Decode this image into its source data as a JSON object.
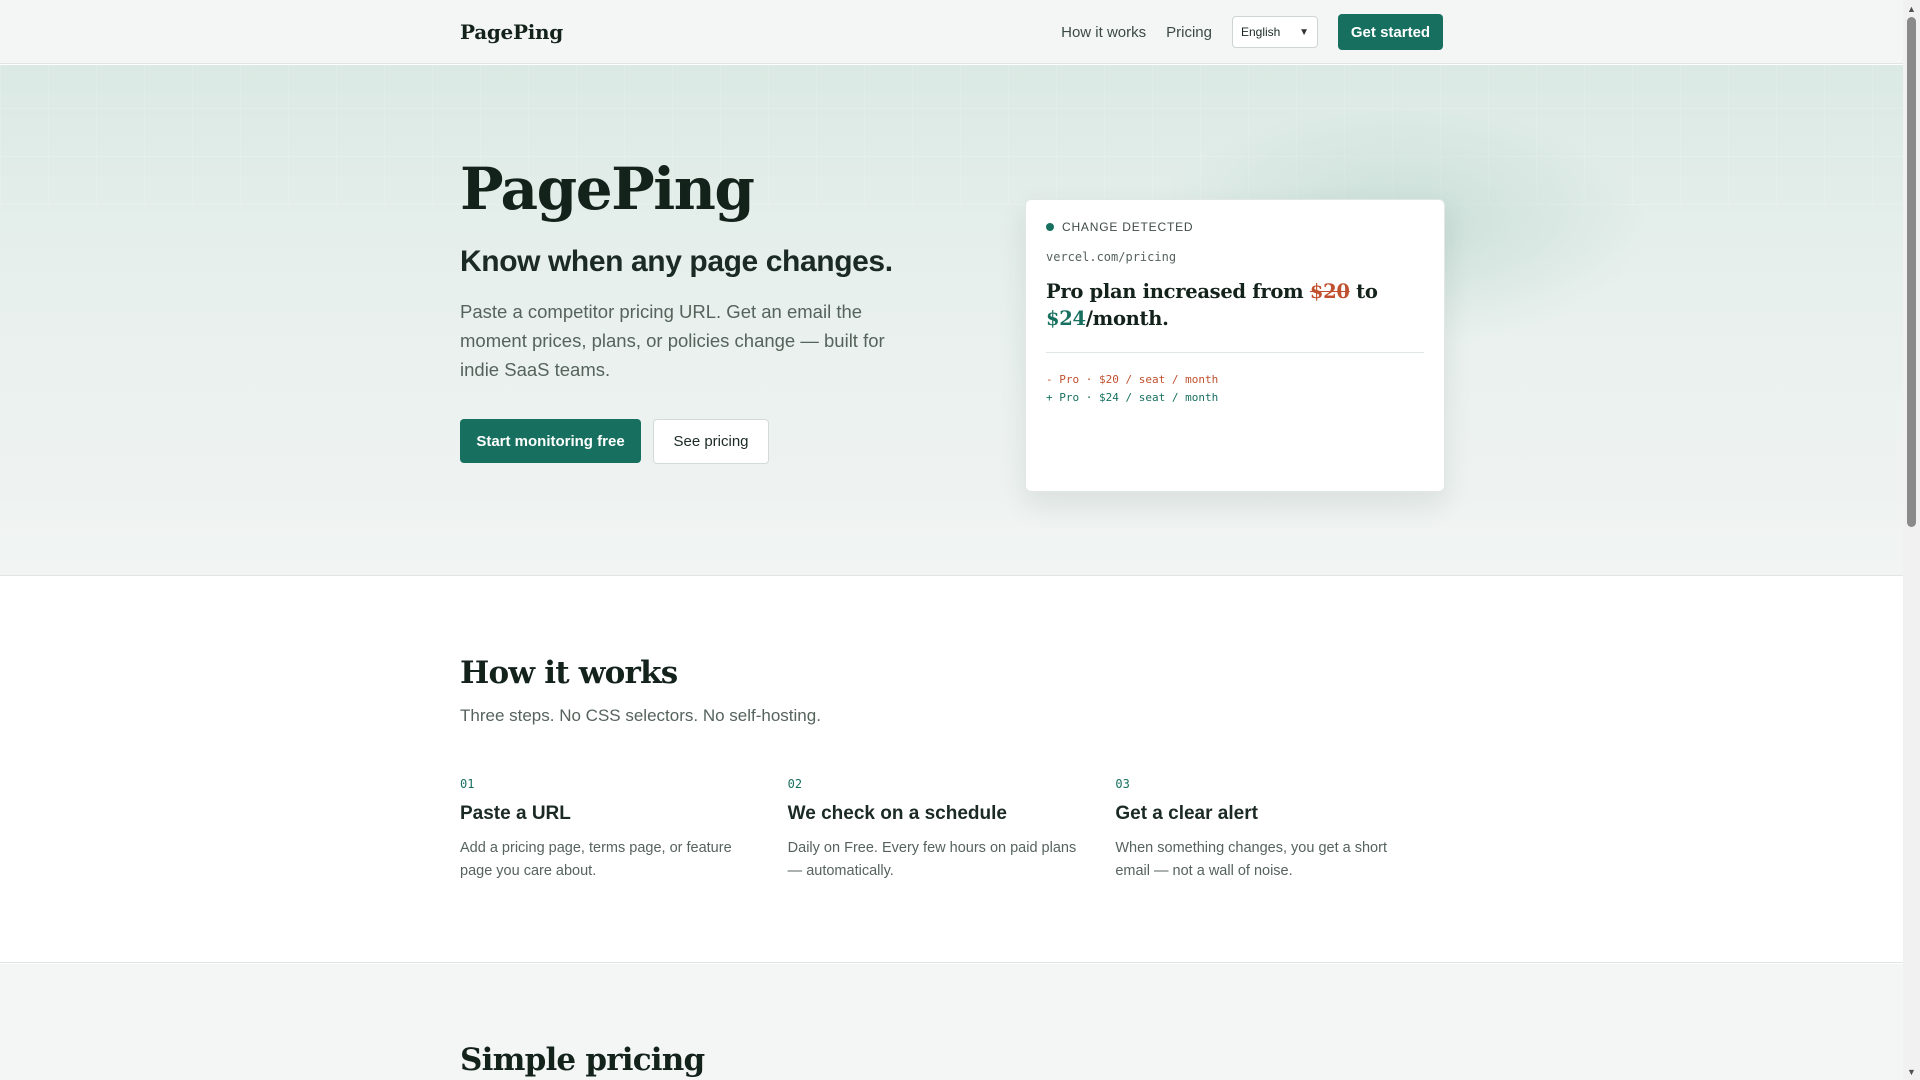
{
  "header": {
    "logo": "PagePing",
    "nav": [
      "How it works",
      "Pricing"
    ],
    "language": "English",
    "cta": "Get started"
  },
  "hero": {
    "title": "PagePing",
    "subtitle": "Know when any page changes.",
    "description": "Paste a competitor pricing URL. Get an email the moment prices, plans, or policies change — built for indie SaaS teams.",
    "primary_cta": "Start monitoring free",
    "secondary_cta": "See pricing"
  },
  "change_card": {
    "status": "CHANGE DETECTED",
    "url": "vercel.com/pricing",
    "headline_prefix": "Pro plan increased from ",
    "old_price": "$20",
    "middle": " to ",
    "new_price": "$24",
    "suffix": "/month.",
    "diff_removed": "- Pro · $20 / seat / month",
    "diff_added": "+ Pro · $24 / seat / month"
  },
  "how_it_works": {
    "title": "How it works",
    "subtitle": "Three steps. No CSS selectors. No self-hosting.",
    "steps": [
      {
        "num": "01",
        "title": "Paste a URL",
        "desc": "Add a pricing page, terms page, or feature page you care about."
      },
      {
        "num": "02",
        "title": "We check on a schedule",
        "desc": "Daily on Free. Every few hours on paid plans — automatically."
      },
      {
        "num": "03",
        "title": "Get a clear alert",
        "desc": "When something changes, you get a short email — not a wall of noise."
      }
    ]
  },
  "pricing": {
    "title": "Simple pricing"
  },
  "icons": {
    "status": "status-dot-icon",
    "select": "chevron-down-icon",
    "scroll_up": "scroll-up-arrow-icon",
    "scroll_down": "scroll-down-arrow-icon"
  },
  "colors": {
    "accent": "#17705f",
    "removed": "#c0502e",
    "text": "#14221c",
    "muted": "#56635d"
  }
}
